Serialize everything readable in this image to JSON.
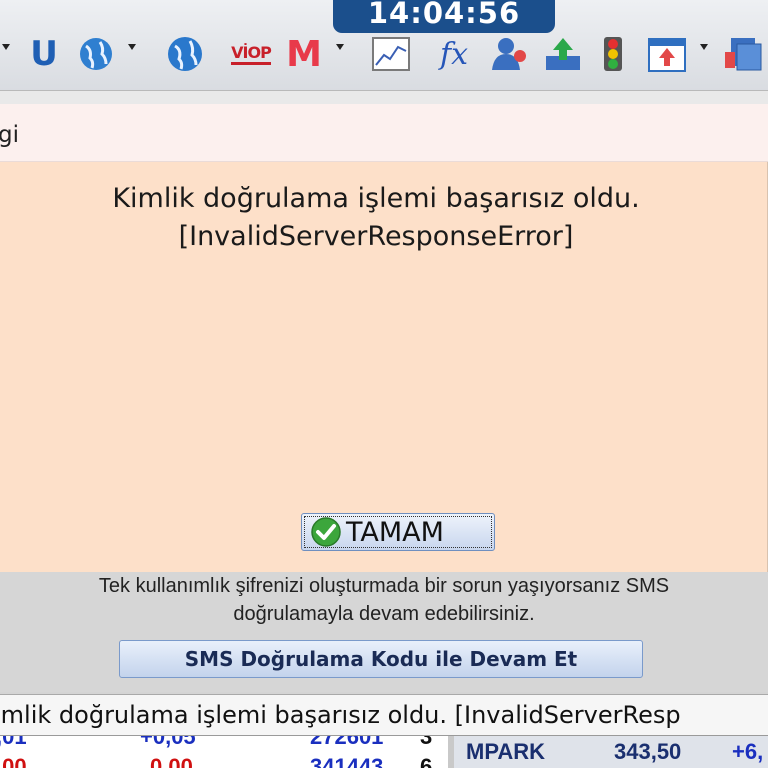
{
  "clock": {
    "time": "14:04:56"
  },
  "toolbar": {
    "items": [
      {
        "name": "u-button",
        "glyph": "U",
        "color": "#1f5fb4"
      },
      {
        "name": "globe-help-icon"
      },
      {
        "name": "globe-icon"
      },
      {
        "name": "viop-icon",
        "text": "VİOP"
      },
      {
        "name": "m-icon",
        "text": "M"
      },
      {
        "name": "chart-icon"
      },
      {
        "name": "function-icon",
        "text": "fx"
      },
      {
        "name": "user-icon"
      },
      {
        "name": "upload-icon"
      },
      {
        "name": "traffic-light-icon"
      },
      {
        "name": "window-up-icon"
      },
      {
        "name": "documents-icon"
      }
    ]
  },
  "dialog": {
    "title": "gi",
    "message_line1": "Kimlik doğrulama işlemi başarısız oldu.",
    "message_line2": "[InvalidServerResponseError]",
    "ok_label": "TAMAM"
  },
  "panel": {
    "sms_info_line1": "Tek kullanımlık şifrenizi oluşturmada bir sorun yaşıyorsanız SMS",
    "sms_info_line2": "doğrulamayla devam edebilirsiniz.",
    "sms_button": "SMS Doğrulama Kodu ile Devam Et"
  },
  "status": {
    "text": "imlik doğrulama işlemi başarısız oldu. [InvalidServerResp"
  },
  "grid": {
    "left_row1": {
      "a": ",01",
      "b": "+0,05",
      "c": "272601",
      "d": "3"
    },
    "left_row2": {
      "a": ",00",
      "b": "0,00",
      "c": "341443",
      "d": "6"
    },
    "right_row": {
      "symbol": "MPARK",
      "price": "343,50",
      "change": "+6,"
    }
  },
  "colors": {
    "dialog_bg": "#fde0c9",
    "clock_bg": "#1b4f8c",
    "accent_blue": "#1a2fbf",
    "down_red": "#d01010"
  }
}
